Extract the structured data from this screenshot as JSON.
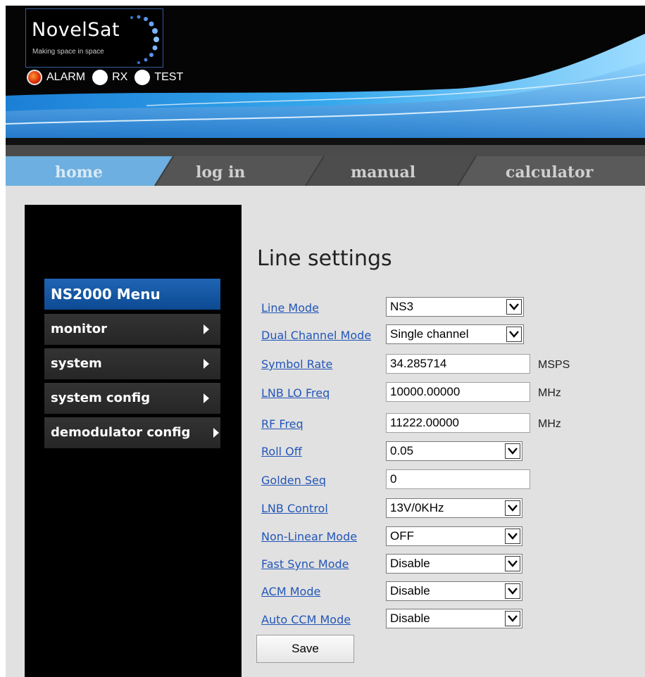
{
  "header": {
    "logo_text": "NovelSat",
    "tagline": "Making space in space",
    "indicators": [
      {
        "label": "ALARM",
        "state": "on",
        "color": "#e0320a"
      },
      {
        "label": "RX",
        "state": "off",
        "color": "#ffffff"
      },
      {
        "label": "TEST",
        "state": "off",
        "color": "#ffffff"
      }
    ]
  },
  "nav": {
    "items": [
      {
        "label": "home",
        "active": true
      },
      {
        "label": "log in",
        "active": false
      },
      {
        "label": "manual",
        "active": false
      },
      {
        "label": "calculator",
        "active": false
      }
    ]
  },
  "sidebar": {
    "title": "NS2000 Menu",
    "items": [
      {
        "label": "monitor"
      },
      {
        "label": "system"
      },
      {
        "label": "system config"
      },
      {
        "label": "demodulator config"
      }
    ]
  },
  "main": {
    "title": "Line settings",
    "fields": [
      {
        "label": "Line Mode",
        "type": "select",
        "value": "NS3"
      },
      {
        "label": "Dual Channel Mode",
        "type": "select",
        "value": "Single channel"
      },
      {
        "label": "Symbol Rate",
        "type": "input",
        "value": "34.285714",
        "unit": "MSPS"
      },
      {
        "label": "LNB LO Freq",
        "type": "input",
        "value": "10000.00000",
        "unit": "MHz"
      },
      {
        "label": "RF Freq",
        "type": "input",
        "value": "11222.00000",
        "unit": "MHz"
      },
      {
        "label": "Roll Off",
        "type": "select",
        "value": "0.05"
      },
      {
        "label": "Golden Seq",
        "type": "input",
        "value": "0"
      },
      {
        "label": "LNB Control",
        "type": "select",
        "value": "13V/0KHz"
      },
      {
        "label": "Non-Linear Mode",
        "type": "select",
        "value": "OFF"
      },
      {
        "label": "Fast Sync Mode",
        "type": "select",
        "value": "Disable"
      },
      {
        "label": "ACM Mode",
        "type": "select",
        "value": "Disable"
      },
      {
        "label": "Auto CCM Mode",
        "type": "select",
        "value": "Disable"
      }
    ],
    "save_label": "Save"
  },
  "colors": {
    "accent": "#1f65b4",
    "link": "#2356b8",
    "page_bg": "#e1e1e1",
    "nav_bg": "#555555"
  }
}
